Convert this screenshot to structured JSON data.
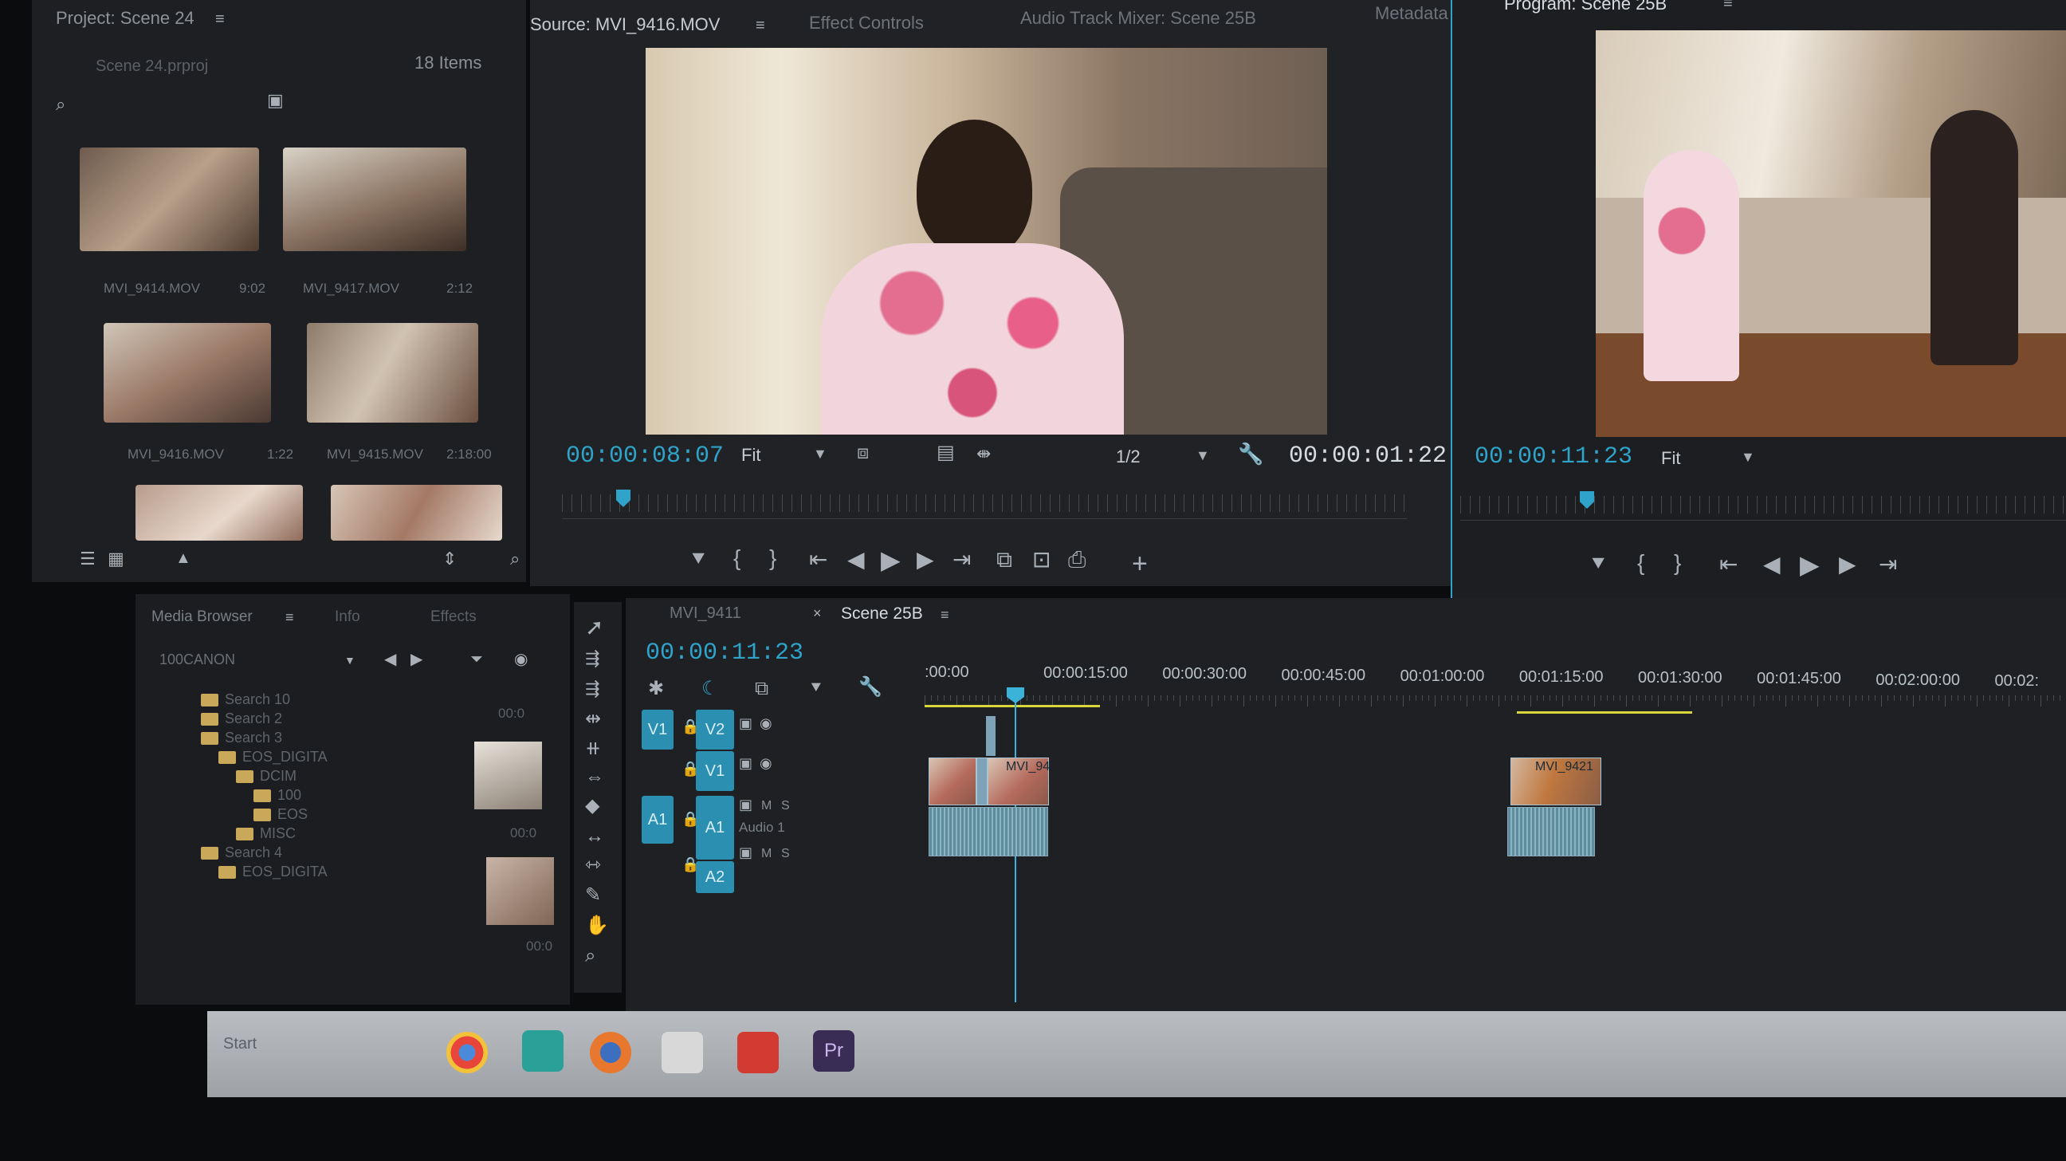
{
  "project": {
    "title": "Project: Scene 24",
    "file": "Scene 24.prproj",
    "item_count": "18 Items",
    "thumbs": [
      {
        "name": "MVI_9414.MOV",
        "duration": "9:02"
      },
      {
        "name": "MVI_9417.MOV",
        "duration": "2:12"
      },
      {
        "name": "MVI_9416.MOV",
        "duration": "1:22"
      },
      {
        "name": "MVI_9415.MOV",
        "duration": "2:18:00"
      }
    ]
  },
  "source": {
    "tabs": [
      "Source: MVI_9416.MOV",
      "Effect Controls",
      "Audio Track Mixer: Scene 25B",
      "Metadata"
    ],
    "timecode": "00:00:08:07",
    "fit": "Fit",
    "resolution": "1/2",
    "duration": "00:00:01:22"
  },
  "program": {
    "title": "Program: Scene 25B",
    "timecode": "00:00:11:23",
    "fit": "Fit"
  },
  "media_browser": {
    "tabs": [
      "Media Browser",
      "Info",
      "Effects"
    ],
    "location": "100CANON",
    "tree": [
      {
        "label": "Search 10",
        "depth": 1
      },
      {
        "label": "Search 2",
        "depth": 1
      },
      {
        "label": "Search 3",
        "depth": 1
      },
      {
        "label": "EOS_DIGITA",
        "depth": 2
      },
      {
        "label": "DCIM",
        "depth": 3
      },
      {
        "label": "100",
        "depth": 4
      },
      {
        "label": "EOS",
        "depth": 4
      },
      {
        "label": "MISC",
        "depth": 3
      },
      {
        "label": "Search 4",
        "depth": 1
      },
      {
        "label": "EOS_DIGITA",
        "depth": 2
      }
    ],
    "preview_times": [
      "00:0",
      "00:0",
      "00:0"
    ]
  },
  "timeline": {
    "tabs": [
      "MVI_9411",
      "Scene 25B"
    ],
    "timecode": "00:00:11:23",
    "ruler": [
      ":00:00",
      "00:00:15:00",
      "00:00:30:00",
      "00:00:45:00",
      "00:01:00:00",
      "00:01:15:00",
      "00:01:30:00",
      "00:01:45:00",
      "00:02:00:00",
      "00:02:"
    ],
    "tracks": {
      "v2": "V2",
      "v1": "V1",
      "a1": "A1",
      "a2": "A2",
      "src_v1": "V1",
      "src_a1": "A1",
      "audio1_name": "Audio 1",
      "m": "M",
      "s": "S"
    },
    "clips": [
      "MVI_94",
      "MVI_9421"
    ]
  },
  "taskbar": {
    "start": "Start",
    "apps": [
      "chrome-icon",
      "globe-icon",
      "firefox-icon",
      "files-icon",
      "creative-cloud-icon",
      "premiere-icon"
    ],
    "premiere_label": "Pr"
  },
  "colors": {
    "accent": "#2fa3c9",
    "panel": "#1d1f22",
    "clip": "#7ea2b7",
    "work_area": "#d7d63a"
  }
}
